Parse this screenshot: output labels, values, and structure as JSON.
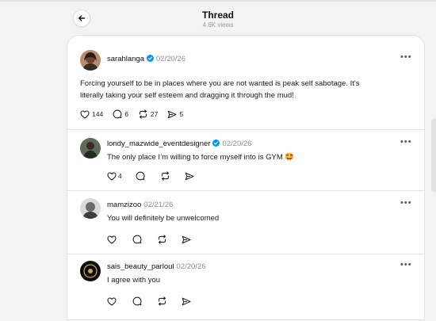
{
  "header": {
    "title": "Thread",
    "views": "4.6K views"
  },
  "main_post": {
    "username": "sarahlanga",
    "date": "02/20/26",
    "text_line1": "Forcing yourself to be in places where you are not wanted is peak self sabotage. It's",
    "text_line2": "literally taking your self esteem and dragging it through the mud!",
    "likes": "144",
    "replies": "6",
    "reposts": "27",
    "shares": "5"
  },
  "replies": [
    {
      "username": "londy_mazwide_eventdesigner",
      "date": "02/20/26",
      "text": "The only place I’m willing to force myself into is GYM 🤩",
      "replies": "4"
    },
    {
      "username": "mamzizoo",
      "date": "02/21/26",
      "text": "You will definitely be unwelcomed"
    },
    {
      "username": "sais_beauty_parloul",
      "date": "02/20/26",
      "text": "I agree with you"
    }
  ],
  "colors": {
    "verified": "#0095f6",
    "background": "#f3f3f3",
    "card": "#ffffff",
    "divider": "#e5e5e5"
  },
  "icons": [
    "back-arrow-icon",
    "verified-icon",
    "heart-icon",
    "comment-icon",
    "repost-icon",
    "share-icon",
    "more-icon"
  ]
}
